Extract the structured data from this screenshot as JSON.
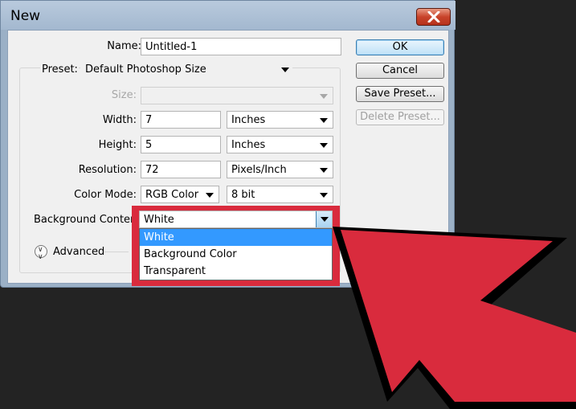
{
  "window": {
    "title": "New"
  },
  "form": {
    "name_label": "Name:",
    "name_value": "Untitled-1",
    "preset_label": "Preset:",
    "preset_value": "Default Photoshop Size",
    "size_label": "Size:",
    "size_value": "",
    "width_label": "Width:",
    "width_value": "7",
    "width_unit": "Inches",
    "height_label": "Height:",
    "height_value": "5",
    "height_unit": "Inches",
    "resolution_label": "Resolution:",
    "resolution_value": "72",
    "resolution_unit": "Pixels/Inch",
    "color_mode_label": "Color Mode:",
    "color_mode_value": "RGB Color",
    "bit_depth_value": "8 bit",
    "background_label": "Background Contents",
    "background_value": "White",
    "background_options": [
      "White",
      "Background Color",
      "Transparent"
    ],
    "advanced_label": "Advanced"
  },
  "buttons": {
    "ok": "OK",
    "cancel": "Cancel",
    "save_preset": "Save Preset...",
    "delete_preset": "Delete Preset..."
  },
  "icons": {
    "close": "close-x-icon",
    "dropdown": "chevron-down-icon",
    "advanced": "double-chevron-down-icon",
    "pointer": "big-red-arrow-icon"
  },
  "colors": {
    "highlight_red": "#d92b3d",
    "selection_blue": "#3399ff",
    "titlebar": "#a3b8cf",
    "backdrop": "#232323"
  }
}
